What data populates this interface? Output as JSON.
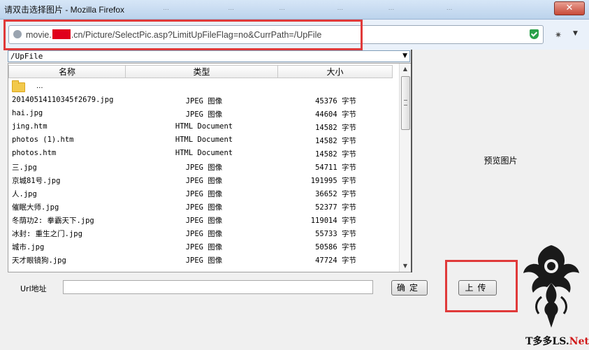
{
  "window": {
    "title": "请双击选择图片 - Mozilla Firefox",
    "background_tabs": [
      "…",
      "…",
      "…",
      "…",
      "…",
      "…",
      "…"
    ],
    "close_symbol": "✕"
  },
  "address_bar": {
    "url_prefix": "movie.",
    "url_suffix": ".cn/Picture/SelectPic.asp?LimitUpFileFlag=no&CurrPath=/UpFile",
    "highlight_color": "#e03a3a"
  },
  "path_select": {
    "value": "/UpFile"
  },
  "file_list": {
    "headers": [
      "名称",
      "类型",
      "大小"
    ],
    "parent_dir": "...",
    "rows": [
      {
        "name": "20140514110345f2679.jpg",
        "type": "JPEG 图像",
        "size": "45376 字节"
      },
      {
        "name": "hai.jpg",
        "type": "JPEG 图像",
        "size": "44604 字节"
      },
      {
        "name": "jing.htm",
        "type": "HTML Document",
        "size": "14582 字节"
      },
      {
        "name": "photos (1).htm",
        "type": "HTML Document",
        "size": "14582 字节"
      },
      {
        "name": "photos.htm",
        "type": "HTML Document",
        "size": "14582 字节"
      },
      {
        "name": "三.jpg",
        "type": "JPEG 图像",
        "size": "54711 字节"
      },
      {
        "name": "京城81号.jpg",
        "type": "JPEG 图像",
        "size": "191995 字节"
      },
      {
        "name": "人.jpg",
        "type": "JPEG 图像",
        "size": "36652 字节"
      },
      {
        "name": "催眠大师.jpg",
        "type": "JPEG 图像",
        "size": "52377 字节"
      },
      {
        "name": "冬荫功2: 拳霸天下.jpg",
        "type": "JPEG 图像",
        "size": "119014 字节"
      },
      {
        "name": "冰封: 重生之门.jpg",
        "type": "JPEG 图像",
        "size": "55733 字节"
      },
      {
        "name": "城市.jpg",
        "type": "JPEG 图像",
        "size": "50586 字节"
      },
      {
        "name": "天才眼镜狗.jpg",
        "type": "JPEG 图像",
        "size": "47724 字节"
      }
    ]
  },
  "preview": {
    "label": "预览图片"
  },
  "bottom": {
    "url_label": "Url地址",
    "url_value": "",
    "confirm_label": "确定",
    "upload_label": "上传"
  },
  "watermark": {
    "text_black": "T",
    "text_mid": "多多LS.",
    "text_red": "Net"
  }
}
